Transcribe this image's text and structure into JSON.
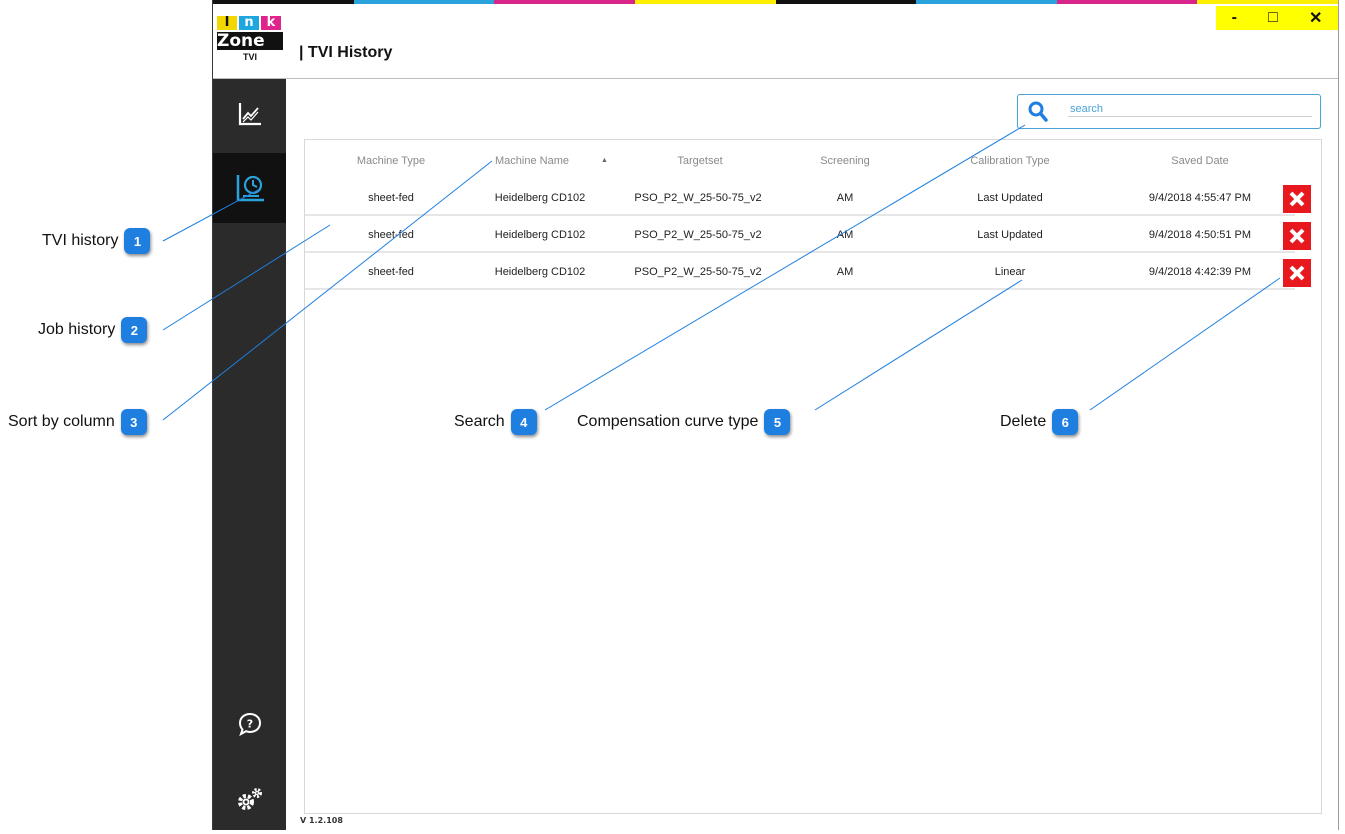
{
  "window": {
    "title": "| TVI History",
    "logo": {
      "letters": [
        "I",
        "n",
        "k"
      ],
      "zone": "Zone",
      "sub": "TVI"
    },
    "controls": {
      "minimize": "-",
      "maximize": "□",
      "close": "✕"
    },
    "version": "V 1.2.108",
    "stripe_colors": [
      "#111111",
      "#2aa3dc",
      "#d8248b",
      "#ffee00",
      "#111111",
      "#2aa3dc",
      "#d8248b",
      "#ffee00"
    ]
  },
  "sidebar": {
    "items": [
      {
        "name": "chart",
        "icon": "line-chart-icon"
      },
      {
        "name": "history",
        "icon": "history-icon",
        "active": true
      },
      {
        "name": "help",
        "icon": "help-chat-icon"
      },
      {
        "name": "settings",
        "icon": "gears-icon"
      }
    ]
  },
  "search": {
    "placeholder": "search",
    "value": ""
  },
  "table": {
    "columns": [
      "Machine Type",
      "Machine Name",
      "Targetset",
      "Screening",
      "Calibration Type",
      "Saved Date"
    ],
    "sort_indicator": "▲",
    "rows": [
      {
        "machine_type": "sheet-fed",
        "machine_name": "Heidelberg CD102",
        "targetset": "PSO_P2_W_25-50-75_v2",
        "screening": "AM",
        "calibration_type": "Last Updated",
        "saved_date": "9/4/2018 4:55:47 PM"
      },
      {
        "machine_type": "sheet-fed",
        "machine_name": "Heidelberg CD102",
        "targetset": "PSO_P2_W_25-50-75_v2",
        "screening": "AM",
        "calibration_type": "Last Updated",
        "saved_date": "9/4/2018 4:50:51 PM"
      },
      {
        "machine_type": "sheet-fed",
        "machine_name": "Heidelberg CD102",
        "targetset": "PSO_P2_W_25-50-75_v2",
        "screening": "AM",
        "calibration_type": "Linear",
        "saved_date": "9/4/2018 4:42:39 PM"
      }
    ]
  },
  "callouts": [
    {
      "num": "1",
      "label": "TVI history"
    },
    {
      "num": "2",
      "label": "Job history"
    },
    {
      "num": "3",
      "label": "Sort by column"
    },
    {
      "num": "4",
      "label": "Search"
    },
    {
      "num": "5",
      "label": "Compensation curve type"
    },
    {
      "num": "6",
      "label": "Delete"
    }
  ],
  "colors": {
    "accent": "#1e7fe0",
    "delete": "#e8191e",
    "sidebar": "#2b2b2b",
    "window_controls": "#ffff00"
  }
}
